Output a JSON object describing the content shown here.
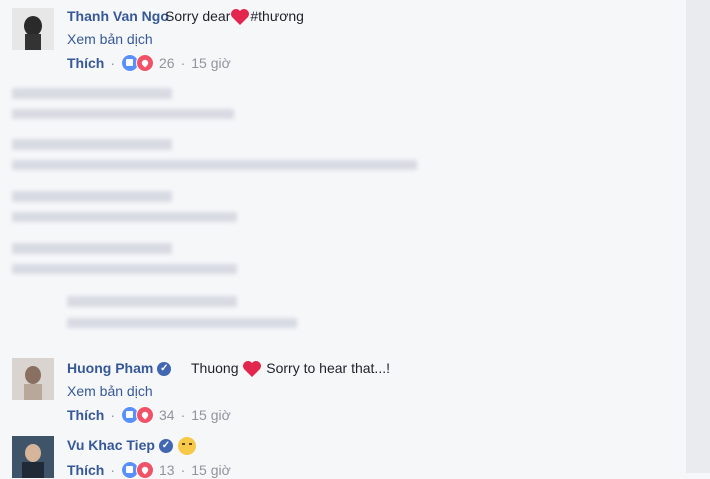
{
  "comments": [
    {
      "name": "Thanh Van Ngo",
      "text_before": "Sorry dear",
      "text_after": "#thương",
      "translate": "Xem bản dịch",
      "like_label": "Thích",
      "count": "26",
      "time": "15 giờ"
    },
    {
      "name": "Huong Pham",
      "text_before": "Thuong",
      "text_after": "Sorry to hear that...!",
      "translate": "Xem bản dịch",
      "like_label": "Thích",
      "count": "34",
      "time": "15 giờ"
    },
    {
      "name": "Vu Khac Tiep",
      "like_label": "Thích",
      "count": "13",
      "time": "15 giờ"
    }
  ],
  "icons": {
    "like_reaction": "like-icon",
    "love_reaction": "love-icon",
    "heart": "heart-icon",
    "verified": "verified-badge-icon",
    "crying": "crying-face-icon"
  },
  "colors": {
    "link": "#365899",
    "meta": "#90949c",
    "heart": "#e2264d",
    "background": "#f6f7f9"
  }
}
